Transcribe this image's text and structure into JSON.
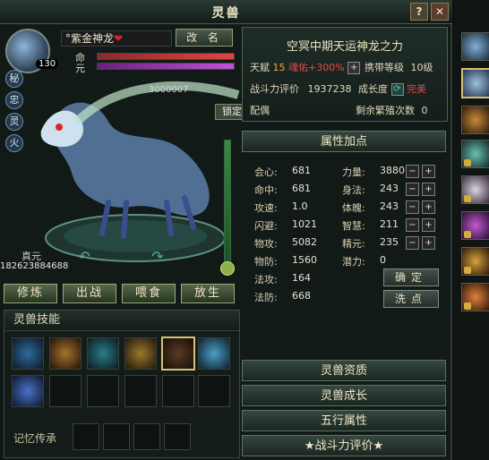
{
  "window": {
    "title": "灵兽",
    "help": "?",
    "close": "✕"
  },
  "pet": {
    "level": "130",
    "name": "°紫金神龙",
    "heart": "❤",
    "rename": "改 名",
    "bar1_label": "命",
    "bar2_label": "元",
    "exp_text": "3000007",
    "lock_label": "锁定",
    "zhenyuan_label": "真元",
    "zhenyuan_value": "182623884688",
    "side_buttons": [
      "秘",
      "忠",
      "灵",
      "火"
    ]
  },
  "actions": [
    "修炼",
    "出战",
    "喂食",
    "放生"
  ],
  "skills": {
    "header": "灵兽技能",
    "memory_label": "记忆传承"
  },
  "info": {
    "title": "空冥中期天运神龙之力",
    "row1_prefix": "天赋",
    "row1_value": "15",
    "row1_bonus": "魂佑+300%",
    "carry_label": "携带等级",
    "carry_value": "10级",
    "power_label": "战斗力评价",
    "power_value": "1937238",
    "growth_label": "成长度",
    "growth_value": "完美",
    "mate_label": "配偶",
    "breed_label": "剩余繁殖次数",
    "breed_value": "0"
  },
  "attributes": {
    "header": "属性加点",
    "left": [
      {
        "label": "会心:",
        "value": "681"
      },
      {
        "label": "命中:",
        "value": "681"
      },
      {
        "label": "攻速:",
        "value": "1.0"
      },
      {
        "label": "闪避:",
        "value": "1021"
      },
      {
        "label": "物攻:",
        "value": "5082"
      },
      {
        "label": "物防:",
        "value": "1560"
      },
      {
        "label": "法攻:",
        "value": "164"
      },
      {
        "label": "法防:",
        "value": "668"
      }
    ],
    "right": [
      {
        "label": "力量:",
        "value": "3880"
      },
      {
        "label": "身法:",
        "value": "243"
      },
      {
        "label": "体魄:",
        "value": "243"
      },
      {
        "label": "智慧:",
        "value": "211"
      },
      {
        "label": "精元:",
        "value": "235"
      },
      {
        "label": "潜力:",
        "value": "0"
      }
    ],
    "confirm": "确定",
    "reset": "洗点"
  },
  "sections": [
    "灵兽资质",
    "灵兽成长",
    "五行属性",
    "★战斗力评价★"
  ],
  "colors": {
    "accent": "#e2b33c",
    "bonus": "#e34a4a",
    "perfect": "#e34a4a",
    "hp_bar": "#c83b3b",
    "mp_bar": "#b046c8"
  }
}
